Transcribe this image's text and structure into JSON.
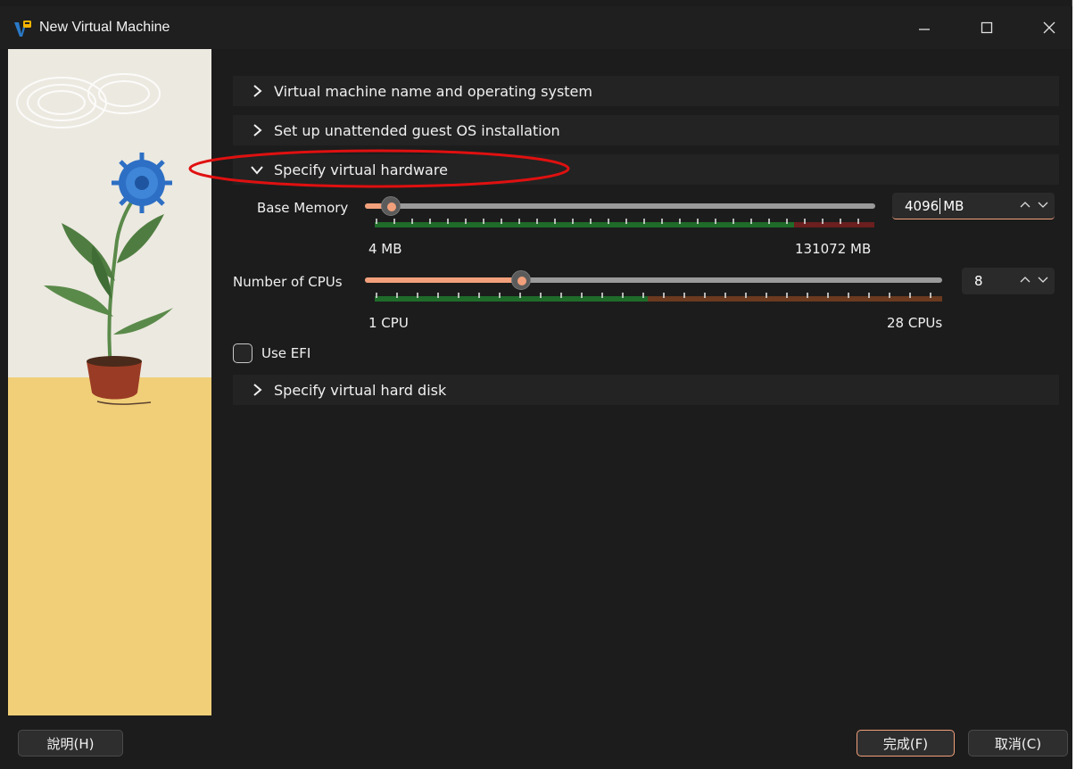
{
  "window": {
    "title": "New Virtual Machine"
  },
  "sections": {
    "name_os": "Virtual machine name and operating system",
    "unattended": "Set up unattended guest OS installation",
    "hardware": "Specify virtual hardware",
    "hard_disk": "Specify virtual hard disk"
  },
  "hardware": {
    "memory": {
      "label": "Base Memory",
      "value": "4096",
      "unit": "MB",
      "min_label": "4 MB",
      "max_label": "131072 MB",
      "slider_fraction": 0.031,
      "min": 4,
      "max": 131072
    },
    "cpus": {
      "label": "Number of CPUs",
      "value": "8",
      "min_label": "1 CPU",
      "max_label": "28 CPUs",
      "min": 1,
      "max": 28
    },
    "efi": {
      "label": "Use EFI",
      "checked": false
    }
  },
  "buttons": {
    "help": "說明(H)",
    "finish": "完成(F)",
    "cancel": "取消(C)"
  },
  "colors": {
    "accent": "#f2a07b",
    "annotation": "#e01010"
  }
}
